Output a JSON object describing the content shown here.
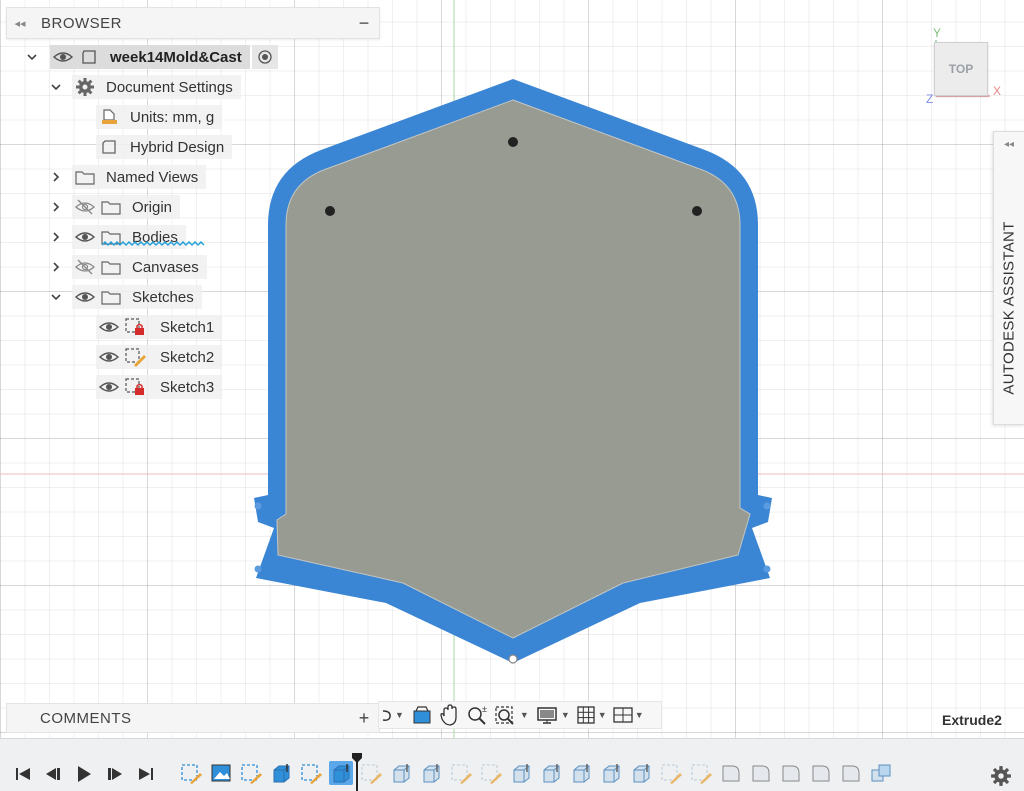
{
  "browser": {
    "title": "BROWSER",
    "collapse_glyph": "◂◂",
    "minimize_glyph": "−",
    "root": {
      "label": "week14Mold&Cast",
      "icon": "component-icon",
      "active_icon": "radio-active-icon"
    },
    "document_settings": {
      "label": "Document Settings",
      "icon": "gear-icon"
    },
    "units": {
      "label": "Units: mm, g",
      "icon": "ruler-icon"
    },
    "hybrid": {
      "label": "Hybrid Design",
      "icon": "body-icon"
    },
    "named_views": {
      "label": "Named Views",
      "icon": "folder-icon"
    },
    "origin": {
      "label": "Origin",
      "icon": "folder-icon",
      "visibility": "hidden"
    },
    "bodies": {
      "label": "Bodies",
      "icon": "folder-icon",
      "visibility": "visible"
    },
    "canvases": {
      "label": "Canvases",
      "icon": "folder-icon",
      "visibility": "hidden"
    },
    "sketches": {
      "label": "Sketches",
      "icon": "folder-icon",
      "visibility": "visible"
    },
    "sketch_items": [
      {
        "label": "Sketch1",
        "state": "locked"
      },
      {
        "label": "Sketch2",
        "state": "editable"
      },
      {
        "label": "Sketch3",
        "state": "locked"
      }
    ]
  },
  "assistant": {
    "label": "AUTODESK ASSISTANT",
    "collapse_glyph": "◂◂"
  },
  "viewcube": {
    "face": "TOP",
    "axis_y": "Y",
    "axis_x": "X",
    "axis_z": "Z"
  },
  "comments": {
    "title": "COMMENTS",
    "add_glyph": "+"
  },
  "feature_name": "Extrude2",
  "colors": {
    "accent_blue": "#3b86d4",
    "body_gray": "#979b92",
    "x_axis": "#e79a9a",
    "y_axis": "#9ccf9c",
    "z_axis": "#7f8ee8"
  },
  "nav_toolbar": [
    "orbit-icon",
    "look-at-icon",
    "pan-icon",
    "zoom-icon",
    "fit-icon",
    "display-settings-icon",
    "grid-icon",
    "viewports-icon"
  ],
  "timeline": {
    "controls": [
      "first-icon",
      "previous-icon",
      "play-icon",
      "next-icon",
      "last-icon"
    ],
    "features": [
      "sketch",
      "canvas",
      "sketch",
      "extrude",
      "sketch",
      "extrude",
      "sketch",
      "extrude",
      "extrude",
      "sketch",
      "sketch",
      "extrude",
      "extrude",
      "extrude",
      "extrude",
      "extrude",
      "sketch",
      "sketch",
      "fillet",
      "fillet",
      "fillet",
      "fillet",
      "fillet",
      "combine"
    ],
    "active_index": 5,
    "settings_icon": "gear-icon"
  }
}
